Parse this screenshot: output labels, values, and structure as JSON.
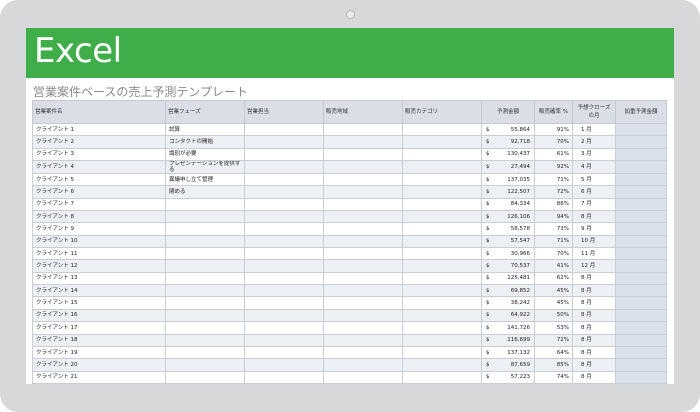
{
  "app": {
    "logo": "Excel"
  },
  "sheet": {
    "title": "営業案件ベースの売上予測テンプレート"
  },
  "columns": [
    "営業案件名",
    "営業フェーズ",
    "営業担当",
    "販売地域",
    "販売カテゴリ",
    "予測金額",
    "販売確率 %",
    "予想クローズの月",
    "加重予測金額"
  ],
  "currency": "$",
  "rows": [
    {
      "name": "クライアント 1",
      "phase": "試算",
      "amount": "55,864",
      "prob": "91%",
      "month": "1 月"
    },
    {
      "name": "クライアント 2",
      "phase": "コンタクトの開始",
      "amount": "92,718",
      "prob": "70%",
      "month": "2 月"
    },
    {
      "name": "クライアント 3",
      "phase": "識別が必要",
      "amount": "130,437",
      "prob": "61%",
      "month": "3 月"
    },
    {
      "name": "クライアント 4",
      "phase": "プレゼンテーションを提供する",
      "amount": "27,494",
      "prob": "92%",
      "month": "4 月"
    },
    {
      "name": "クライアント 5",
      "phase": "異議申し立て管理",
      "amount": "137,035",
      "prob": "71%",
      "month": "5 月"
    },
    {
      "name": "クライアント 6",
      "phase": "閉める",
      "amount": "122,507",
      "prob": "72%",
      "month": "6 月"
    },
    {
      "name": "クライアント 7",
      "phase": "",
      "amount": "84,334",
      "prob": "86%",
      "month": "7 月"
    },
    {
      "name": "クライアント 8",
      "phase": "",
      "amount": "126,106",
      "prob": "94%",
      "month": "8 月"
    },
    {
      "name": "クライアント 9",
      "phase": "",
      "amount": "58,578",
      "prob": "73%",
      "month": "9 月"
    },
    {
      "name": "クライアント 10",
      "phase": "",
      "amount": "57,547",
      "prob": "71%",
      "month": "10 月"
    },
    {
      "name": "クライアント 11",
      "phase": "",
      "amount": "30,966",
      "prob": "70%",
      "month": "11 月"
    },
    {
      "name": "クライアント 12",
      "phase": "",
      "amount": "70,537",
      "prob": "41%",
      "month": "12 月"
    },
    {
      "name": "クライアント 13",
      "phase": "",
      "amount": "125,481",
      "prob": "62%",
      "month": "8 月"
    },
    {
      "name": "クライアント 14",
      "phase": "",
      "amount": "69,852",
      "prob": "45%",
      "month": "8 月"
    },
    {
      "name": "クライアント 15",
      "phase": "",
      "amount": "38,242",
      "prob": "45%",
      "month": "8 月"
    },
    {
      "name": "クライアント 16",
      "phase": "",
      "amount": "64,922",
      "prob": "50%",
      "month": "8 月"
    },
    {
      "name": "クライアント 17",
      "phase": "",
      "amount": "141,726",
      "prob": "53%",
      "month": "8 月"
    },
    {
      "name": "クライアント 18",
      "phase": "",
      "amount": "116,699",
      "prob": "72%",
      "month": "8 月"
    },
    {
      "name": "クライアント 19",
      "phase": "",
      "amount": "137,132",
      "prob": "64%",
      "month": "8 月"
    },
    {
      "name": "クライアント 20",
      "phase": "",
      "amount": "87,659",
      "prob": "85%",
      "month": "8 月"
    },
    {
      "name": "クライアント 21",
      "phase": "",
      "amount": "57,223",
      "prob": "74%",
      "month": "8 月"
    }
  ]
}
